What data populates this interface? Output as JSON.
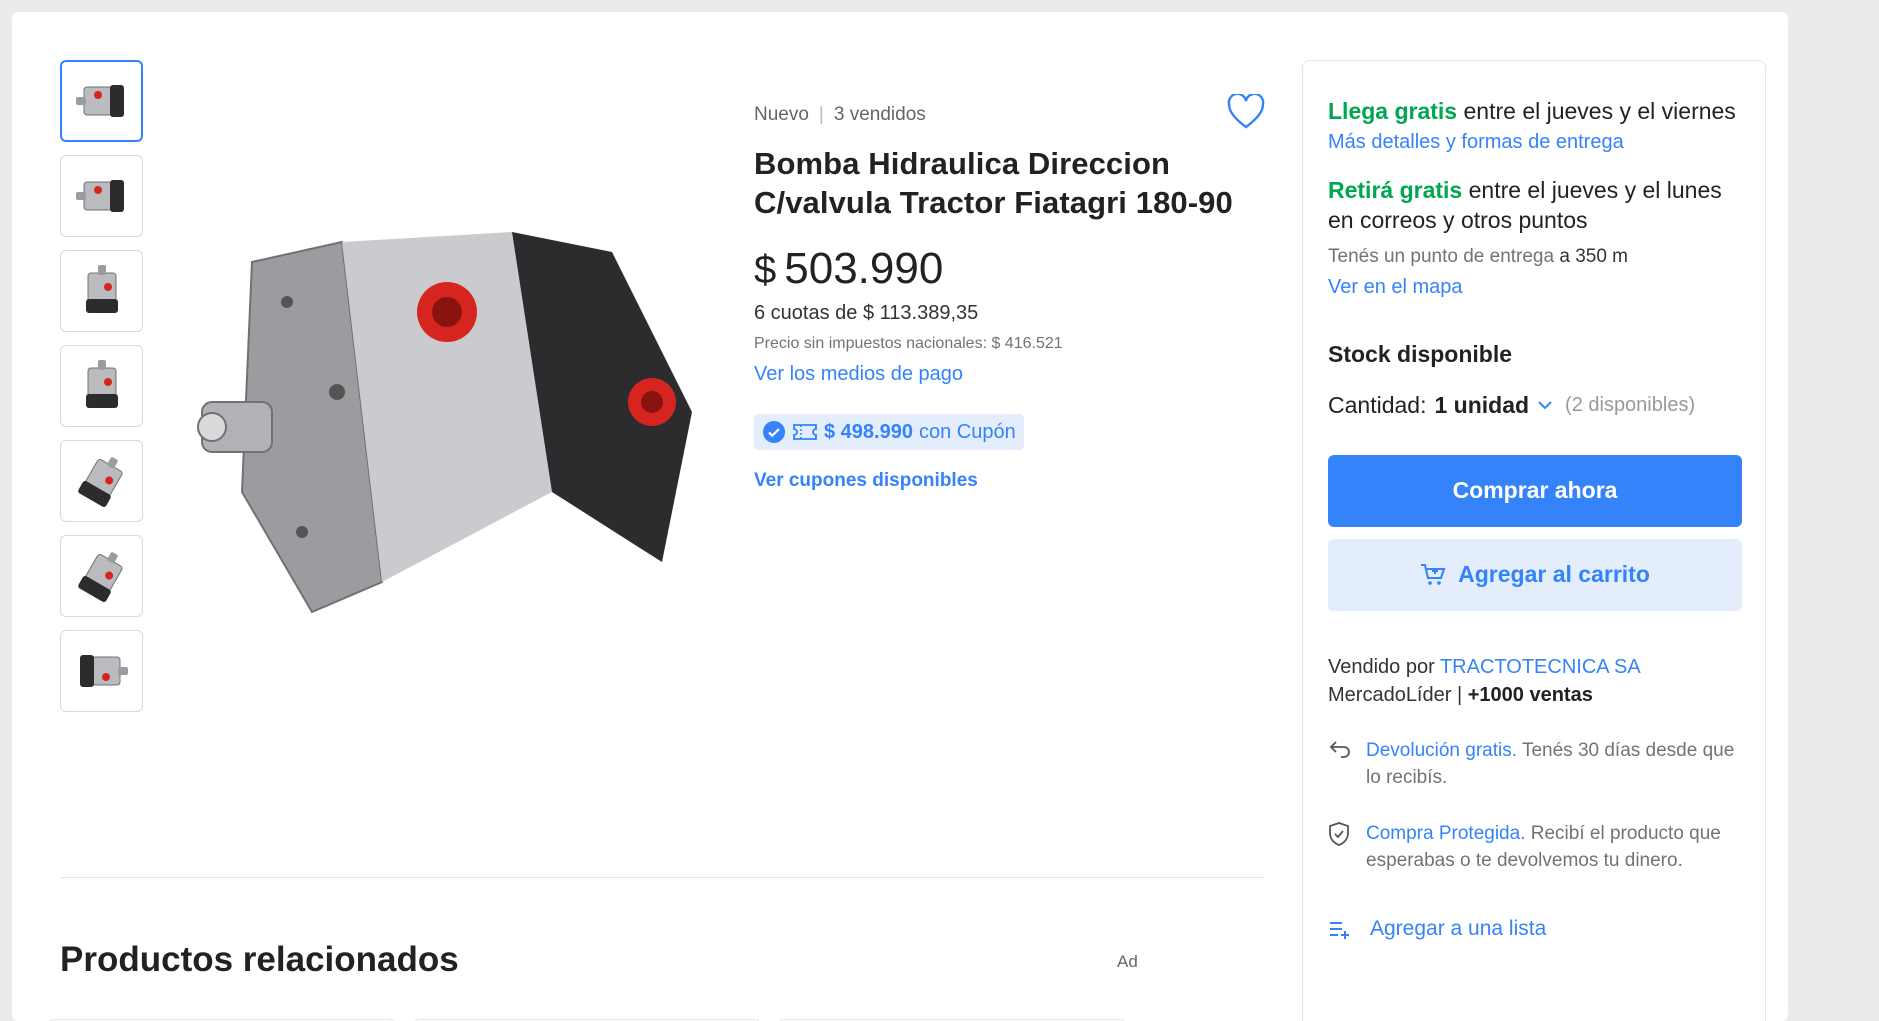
{
  "product": {
    "condition": "Nuevo",
    "sold": "3 vendidos",
    "title": "Bomba Hidraulica Direccion C/valvula Tractor Fiatagri 180-90",
    "currency": "$",
    "price": "503.990",
    "installments": "6 cuotas de $ 113.389,35",
    "tax_note": "Precio sin impuestos nacionales: $ 416.521",
    "payment_link": "Ver los medios de pago",
    "coupon_amount": "$ 498.990",
    "coupon_suffix": "con Cupón",
    "coupons_link": "Ver cupones disponibles"
  },
  "gallery": {
    "thumbnail_count": 7,
    "selected_index": 0
  },
  "related": {
    "title": "Productos relacionados",
    "ad_label": "Ad"
  },
  "sidebar": {
    "shipping_highlight": "Llega gratis",
    "shipping_text": "entre el jueves y el viernes",
    "shipping_link": "Más detalles y formas de entrega",
    "pickup_highlight": "Retirá gratis",
    "pickup_text": "entre el jueves y el lunes en correos y otros puntos",
    "point_text": "Tenés un punto de entrega",
    "point_distance": "a 350 m",
    "map_link": "Ver en el mapa",
    "stock": "Stock disponible",
    "qty_label": "Cantidad:",
    "qty_value": "1 unidad",
    "qty_available": "(2 disponibles)",
    "buy_now": "Comprar ahora",
    "add_to_cart": "Agregar al carrito",
    "sold_by_label": "Vendido por",
    "seller_name": "TRACTOTECNICA SA",
    "seller_level": "MercadoLíder |",
    "seller_sales": "+1000 ventas",
    "return_link": "Devolución gratis.",
    "return_text": "Tenés 30 días desde que lo recibís.",
    "protected_link": "Compra Protegida.",
    "protected_text": "Recibí el producto que esperabas o te devolvemos tu dinero.",
    "add_list": "Agregar a una lista"
  },
  "colors": {
    "accent": "#3483fa",
    "green": "#00a650",
    "accent_light": "#e3edfb"
  },
  "icons": [
    "heart-icon",
    "check-circle-icon",
    "ticket-icon",
    "chevron-down-icon",
    "cart-plus-icon",
    "return-arrow-icon",
    "shield-check-icon",
    "list-add-icon"
  ]
}
